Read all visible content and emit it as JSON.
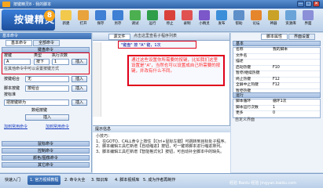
{
  "window": {
    "title": "按键精灵8 - 我的脚本",
    "controls": [
      "—",
      "□",
      "✕"
    ]
  },
  "logo": {
    "text": "按键精灵",
    "badge": "8"
  },
  "toolbar": [
    {
      "label": "新建",
      "color": "#f2c94c"
    },
    {
      "label": "打开",
      "color": "#e8a33c"
    },
    {
      "label": "保存",
      "color": "#3f7fd4"
    },
    {
      "label": "另存",
      "color": "#3f7fd4"
    },
    {
      "label": "调试",
      "color": "#4caf50"
    },
    {
      "label": "运行",
      "color": "#2e9e4a"
    },
    {
      "label": "停止",
      "color": "#d9423b"
    },
    {
      "label": "录制",
      "color": "#e05252"
    },
    {
      "label": "小精灵",
      "color": "#7b57c9"
    },
    {
      "label": "发布",
      "color": "#3b8fd9"
    },
    {
      "label": "帮助",
      "color": "#5e8fc9"
    },
    {
      "label": "论坛",
      "color": "#e6862c"
    },
    {
      "label": "神器",
      "color": "#c9a227"
    },
    {
      "label": "资源库",
      "color": "#6aa3d8"
    },
    {
      "label": "界面",
      "color": "#8a8fd8"
    }
  ],
  "left": {
    "header": "基本命令",
    "tabs": [
      "基本命令",
      "全部命令"
    ],
    "group_keyboard": "键盘命令",
    "key_label": "按键",
    "key_value": "A",
    "type_label": "类型",
    "type_value": "按下",
    "count_label": "执行次数",
    "count_value": "1",
    "insert_label": "插入",
    "hint": "在其他命令中可以设置按键方式",
    "combo_label": "按键组合",
    "combo_value": "无",
    "insert2_label": "插入",
    "script_label": "脚本按键",
    "script_value": "按组合",
    "script_options": "按标准",
    "insert3_label": "插入",
    "cmd_row": "把按键转为",
    "cmd_btn": "插入",
    "list_label": "数组按键",
    "list_value": "插入",
    "link1": "加到常用命令",
    "link2": "加到常用命令",
    "group_mouse": "鼠标命令",
    "group_control": "控制命令",
    "group_color": "颜色/图像命令",
    "group_other": "其它命令"
  },
  "editor": {
    "tab_label": "源文件",
    "tab_hint": "点击这里查看子程序列表",
    "code_line": "\"键盘\" 按 \"A\" 键，1次",
    "callout": "通过这些设置你所需要的按键，比如我们这里设置是“A”，当然也可以设置成自己所需要的按键，并改有什么不同。",
    "tips_header": "提示信息",
    "tips": [
      "小技巧：",
      "1、在GOTO、CALL命令上按住【Ctrl+鼠标左键】可跳转到目标处子程序。",
      "2、脚本编辑工具栏新增【自动缩进】按钮，可一键将脚本进行缩进排列。",
      "3、脚本编辑工具栏新增【智能格式化】按钮，可自动补全脚本中的缺失。"
    ]
  },
  "right": {
    "header": "脚本属性",
    "tabs": [
      "脚本属性",
      "界面设置"
    ],
    "section_basic": "基本",
    "props": [
      {
        "k": "名称",
        "v": "我的脚本"
      },
      {
        "k": "文件名",
        "v": ""
      },
      {
        "k": "描述",
        "v": ""
      },
      {
        "k": "启动热键",
        "v": "F10"
      },
      {
        "k": "暂停/继续热键",
        "v": ""
      },
      {
        "k": "终止热键",
        "v": "F12"
      },
      {
        "k": "全屏中止热键",
        "v": "F12"
      },
      {
        "k": "暂停热键",
        "v": ""
      }
    ],
    "section_run": "运行",
    "props2": [
      {
        "k": "脚本循环",
        "v": "循环1次"
      },
      {
        "k": "脚本运行次数",
        "v": "1"
      },
      {
        "k": "更多",
        "v": "0"
      }
    ],
    "custom": "自定义界面"
  },
  "bottom": {
    "tabs": [
      "快速入门",
      "1. 官方视频教程",
      "2. 命令大全",
      "3. 知识库",
      "4. 脚本视频库",
      "5. 成为作者再制作"
    ],
    "watermark": "经验 Baidu 经验 jingyan.baidu.com"
  }
}
